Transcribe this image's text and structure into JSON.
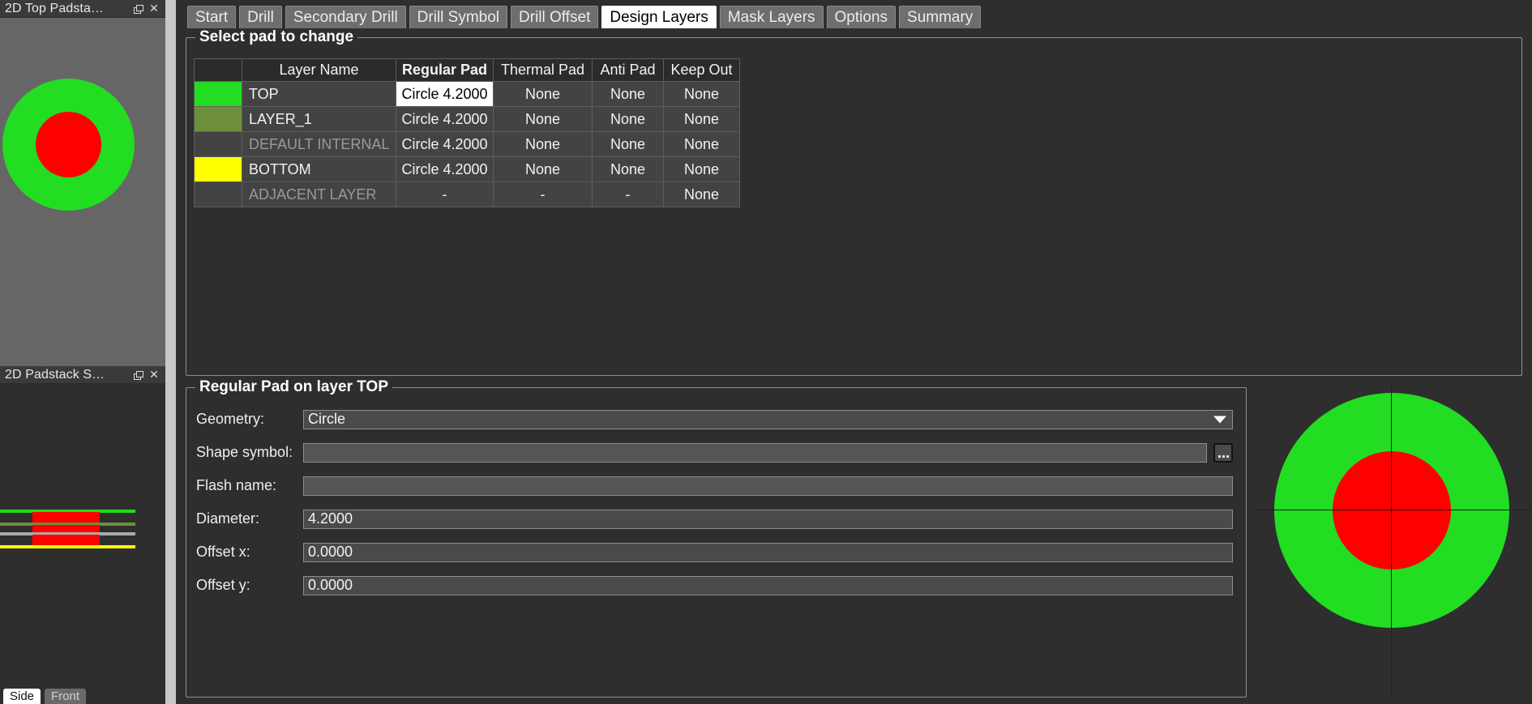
{
  "left_dock": {
    "panels": [
      {
        "title": "2D Top Padsta…",
        "float_icon": "restore-icon",
        "close_icon": "close-icon",
        "view_background": "#666666",
        "pad_outer_color": "#22DD22",
        "pad_inner_color": "#FF0000"
      },
      {
        "title": "2D Padstack S…",
        "float_icon": "restore-icon",
        "close_icon": "close-icon",
        "view_background": "#2e2e2e",
        "cross_section_layers": [
          {
            "name": "TOP",
            "color": "#22DD22"
          },
          {
            "name": "LAYER_1",
            "color": "#6E8F3A"
          },
          {
            "name": "DEFAULT INTERNAL",
            "color": "#AAAAAA"
          },
          {
            "name": "BOTTOM",
            "color": "#FFFF00"
          }
        ],
        "barrel_color": "#FF0000"
      }
    ],
    "bottom_tabs": [
      {
        "label": "Side",
        "active": true
      },
      {
        "label": "Front",
        "active": false
      }
    ]
  },
  "tabs": [
    {
      "label": "Start",
      "active": false
    },
    {
      "label": "Drill",
      "active": false
    },
    {
      "label": "Secondary Drill",
      "active": false
    },
    {
      "label": "Drill Symbol",
      "active": false
    },
    {
      "label": "Drill Offset",
      "active": false
    },
    {
      "label": "Design Layers",
      "active": true
    },
    {
      "label": "Mask Layers",
      "active": false
    },
    {
      "label": "Options",
      "active": false
    },
    {
      "label": "Summary",
      "active": false
    }
  ],
  "select_pad_group": {
    "legend": "Select pad to change",
    "columns": [
      {
        "key": "swatch",
        "label": ""
      },
      {
        "key": "layer_name",
        "label": "Layer Name",
        "bold": false
      },
      {
        "key": "regular_pad",
        "label": "Regular Pad",
        "bold": true
      },
      {
        "key": "thermal_pad",
        "label": "Thermal Pad",
        "bold": false
      },
      {
        "key": "anti_pad",
        "label": "Anti Pad",
        "bold": false
      },
      {
        "key": "keep_out",
        "label": "Keep Out",
        "bold": false
      }
    ],
    "rows": [
      {
        "swatch_color": "#22DD22",
        "layer_name": "TOP",
        "muted": false,
        "regular_pad": "Circle 4.2000",
        "selected_cell": "regular_pad",
        "thermal_pad": "None",
        "anti_pad": "None",
        "keep_out": "None"
      },
      {
        "swatch_color": "#6E8F3A",
        "layer_name": "LAYER_1",
        "muted": false,
        "regular_pad": "Circle 4.2000",
        "selected_cell": "",
        "thermal_pad": "None",
        "anti_pad": "None",
        "keep_out": "None"
      },
      {
        "swatch_color": "",
        "layer_name": "DEFAULT INTERNAL",
        "muted": true,
        "regular_pad": "Circle 4.2000",
        "selected_cell": "",
        "thermal_pad": "None",
        "anti_pad": "None",
        "keep_out": "None"
      },
      {
        "swatch_color": "#FFFF00",
        "layer_name": "BOTTOM",
        "muted": false,
        "regular_pad": "Circle 4.2000",
        "selected_cell": "",
        "thermal_pad": "None",
        "anti_pad": "None",
        "keep_out": "None"
      },
      {
        "swatch_color": "",
        "layer_name": "ADJACENT LAYER",
        "muted": true,
        "regular_pad": "-",
        "selected_cell": "",
        "thermal_pad": "-",
        "anti_pad": "-",
        "keep_out": "None"
      }
    ]
  },
  "regular_pad_group": {
    "legend": "Regular Pad on layer TOP",
    "fields": [
      {
        "label": "Geometry:",
        "value": "Circle",
        "type": "combobox",
        "empty": false
      },
      {
        "label": "Shape symbol:",
        "value": "",
        "type": "text-with-browse",
        "empty": true,
        "browse_label": "..."
      },
      {
        "label": "Flash name:",
        "value": "",
        "type": "text",
        "empty": true
      },
      {
        "label": "Diameter:",
        "value": "4.2000",
        "type": "text",
        "empty": false
      },
      {
        "label": "Offset x:",
        "value": "0.0000",
        "type": "text",
        "empty": false
      },
      {
        "label": "Offset y:",
        "value": "0.0000",
        "type": "text",
        "empty": false
      }
    ]
  },
  "right_preview": {
    "outer_color": "#22DD22",
    "inner_color": "#FF0000",
    "crosshair_color": "#1f1f1f",
    "background": "#2e2e2e"
  },
  "colors": {
    "window_bg": "#2e2e2e",
    "panel_header": "#3a3a3a",
    "table_row_bg": "#434343",
    "table_header_bg": "#2b2b2b",
    "selected_bg": "#ffffff",
    "border": "#8e8e8e",
    "splitter": "#c8c8c8"
  }
}
